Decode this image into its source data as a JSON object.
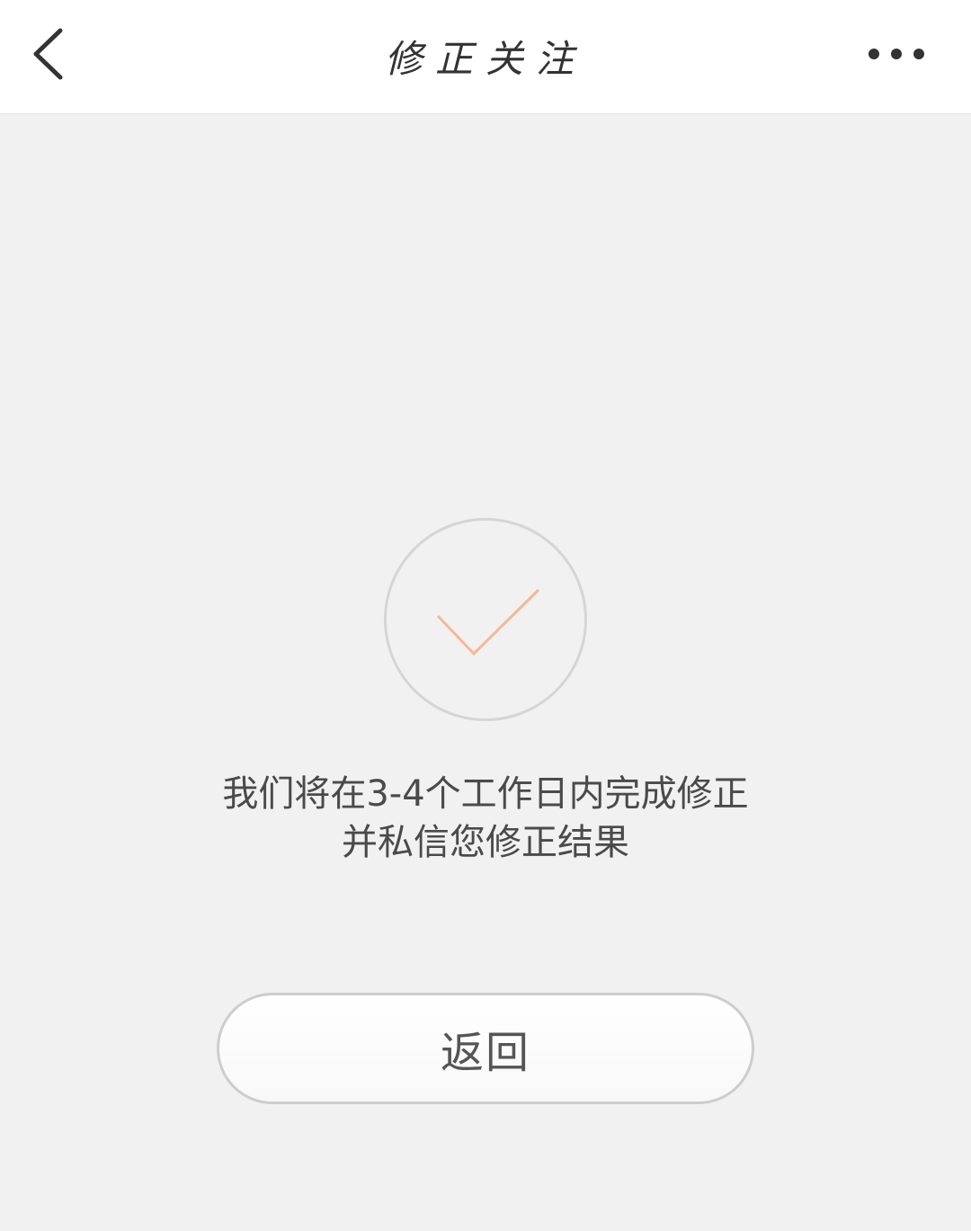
{
  "header": {
    "title": "修正关注",
    "back_icon": "chevron-left-icon",
    "more_icon": "more-horizontal-icon"
  },
  "result": {
    "icon": "check-icon",
    "check_color": "#f5b896",
    "circle_color": "#d5d5d5",
    "line1": "我们将在3-4个工作日内完成修正",
    "line2": "并私信您修正结果"
  },
  "actions": {
    "return_label": "返回"
  }
}
